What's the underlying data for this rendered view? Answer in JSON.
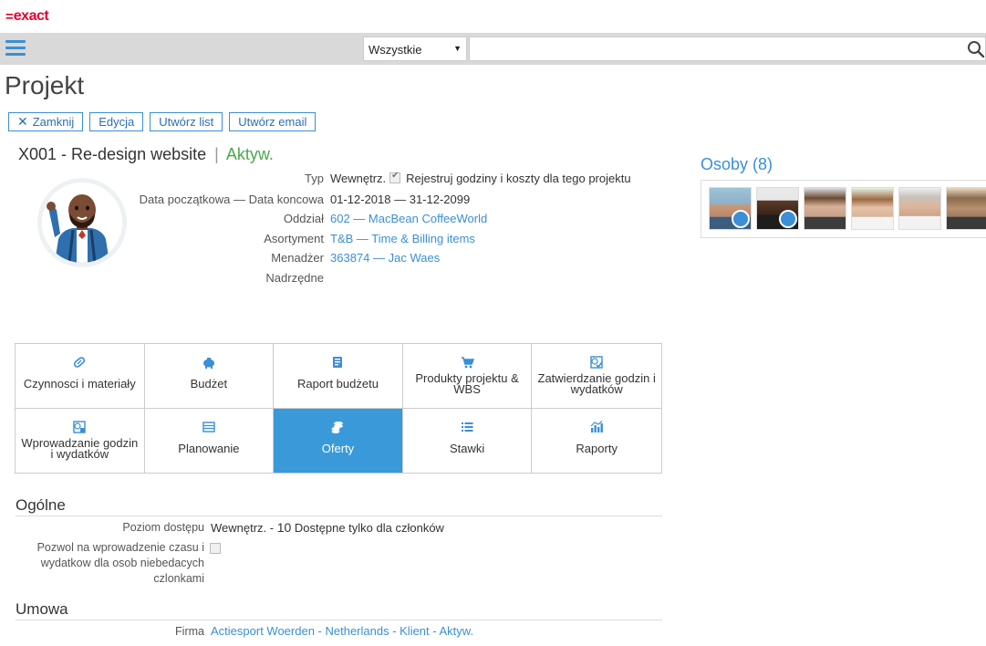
{
  "app": {
    "logo_symbol": "=",
    "logo_text": "exact",
    "brand_color": "#e4002b",
    "accent_color": "#3a8fd6"
  },
  "search": {
    "scope_value": "Wszystkie",
    "scope_arrow": "▼",
    "placeholder": ""
  },
  "page": {
    "title": "Projekt"
  },
  "toolbar": {
    "close_label": "Zamknij",
    "edit_label": "Edycja",
    "create_letter_label": "Utwórz list",
    "create_email_label": "Utwórz email"
  },
  "project": {
    "code_name": "X001 - Re-design website",
    "separator": "|",
    "status": "Aktyw."
  },
  "fields": [
    {
      "label": "Typ",
      "value": "Wewnętrz.",
      "extra": "Rejestruj godziny i koszty dla tego projektu"
    },
    {
      "label": "Data początkowa — Data koncowa",
      "value": "01-12-2018 — 31-12-2099"
    },
    {
      "label": "Oddział",
      "value": "602 — MacBean CoffeeWorld"
    },
    {
      "label": "Asortyment",
      "value": "T&B — Time & Billing items"
    },
    {
      "label": "Menadżer",
      "value": "363874 — Jac Waes"
    },
    {
      "label": "Nadrzędne",
      "value": ""
    }
  ],
  "persons": {
    "title": "Osoby (8)"
  },
  "tiles": [
    {
      "label": "Czynnosci i materiały",
      "icon": "pill-icon"
    },
    {
      "label": "Budżet",
      "icon": "piggy-bank-icon"
    },
    {
      "label": "Raport budżetu",
      "icon": "report-book-icon"
    },
    {
      "label": "Produkty projektu & WBS",
      "icon": "cart-icon"
    },
    {
      "label": "Zatwierdzanie godzin i wydatków",
      "icon": "approve-clock-icon"
    },
    {
      "label": "Wprowadzanie godzin i wydatków",
      "icon": "enter-clock-icon"
    },
    {
      "label": "Planowanie",
      "icon": "planning-list-icon"
    },
    {
      "label": "Oferty",
      "icon": "coins-icon"
    },
    {
      "label": "Stawki",
      "icon": "rates-list-icon"
    },
    {
      "label": "Raporty",
      "icon": "bar-chart-icon"
    }
  ],
  "general": {
    "title": "Ogólne",
    "access_label": "Poziom dostępu",
    "access_value": "Wewnętrz. - ",
    "access_code": "10",
    "access_desc": " Dostępne tylko dla członków",
    "allow_label_line1": "Pozwol na wprowadzenie czasu i",
    "allow_label_line2": "wydatkow dla osob niebedacych",
    "allow_label_line3": "czlonkami"
  },
  "contract": {
    "title": "Umowa",
    "company_label": "Firma",
    "company_value": "Actiesport Woerden - Netherlands - Klient - Aktyw."
  }
}
